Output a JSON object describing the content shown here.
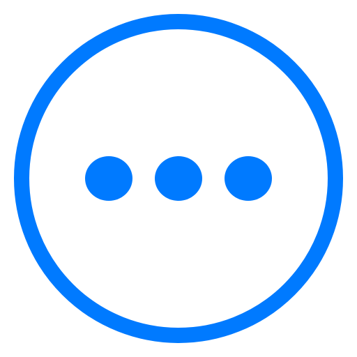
{
  "icon": {
    "name": "more-horizontal-circle-icon",
    "accent_color": "#007AFF",
    "background_color": "#FFFFFF",
    "dot_count": 3
  }
}
